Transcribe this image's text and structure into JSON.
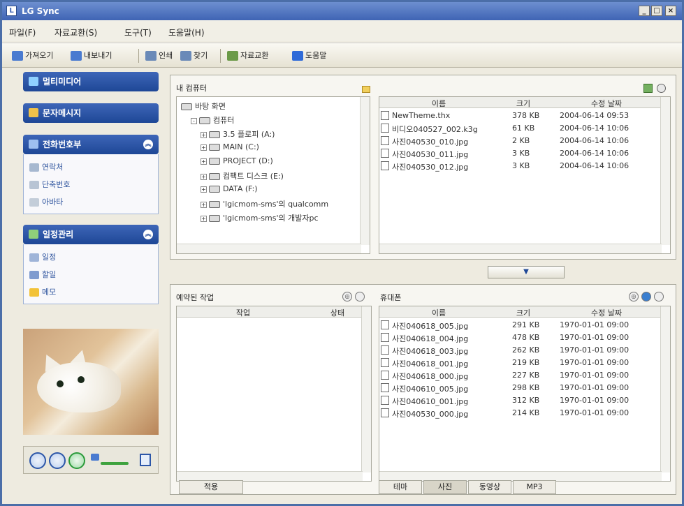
{
  "window": {
    "title": "LG Sync",
    "min_label": "_",
    "max_label": "□",
    "close_label": "×"
  },
  "menu": [
    "파일(F)",
    "자료교환(S)",
    "도구(T)",
    "도움말(H)"
  ],
  "toolbar": [
    {
      "label": "가져오기",
      "icon": "import-icon",
      "color": "#4a7bd0"
    },
    {
      "label": "내보내기",
      "icon": "export-icon",
      "color": "#4a7bd0"
    },
    {
      "label": "인쇄",
      "icon": "print-icon",
      "color": "#6a8ab8"
    },
    {
      "label": "찾기",
      "icon": "find-icon",
      "color": "#6a8ab8"
    },
    {
      "label": "자료교환",
      "icon": "exchange-icon",
      "color": "#6b9a48"
    },
    {
      "label": "도움말",
      "icon": "help-icon",
      "color": "#2f6bd8"
    }
  ],
  "sidebar": {
    "multimedia": "멀티미디어",
    "messages": "문자메시지",
    "phonebook": {
      "title": "전화번호부",
      "items": [
        "연락처",
        "단축번호",
        "아바타"
      ]
    },
    "schedule": {
      "title": "일정관리",
      "items": [
        "일정",
        "할일",
        "메모"
      ]
    }
  },
  "mycomputer": {
    "label": "내 컴퓨터",
    "tree": [
      {
        "label": "바탕 화면",
        "level": 0,
        "expander": ""
      },
      {
        "label": "컴퓨터",
        "level": 1,
        "expander": "-"
      },
      {
        "label": "3.5 플로피 (A:)",
        "level": 2,
        "expander": "+"
      },
      {
        "label": "MAIN (C:)",
        "level": 2,
        "expander": "+"
      },
      {
        "label": "PROJECT (D:)",
        "level": 2,
        "expander": "+"
      },
      {
        "label": "컴팩트 디스크 (E:)",
        "level": 2,
        "expander": "+"
      },
      {
        "label": "DATA (F:)",
        "level": 2,
        "expander": "+"
      },
      {
        "label": "'lgicmom-sms'의 qualcomm",
        "level": 2,
        "expander": "+"
      },
      {
        "label": "'lgicmom-sms'의 개발자pc",
        "level": 2,
        "expander": "+"
      }
    ],
    "headers": {
      "name": "이름",
      "size": "크기",
      "date": "수정 날짜"
    },
    "files": [
      {
        "name": "NewTheme.thx",
        "size": "378 KB",
        "date": "2004-06-14 09:53"
      },
      {
        "name": "비디오040527_002.k3g",
        "size": "61 KB",
        "date": "2004-06-14 10:06"
      },
      {
        "name": "사진040530_010.jpg",
        "size": "2 KB",
        "date": "2004-06-14 10:06"
      },
      {
        "name": "사진040530_011.jpg",
        "size": "3 KB",
        "date": "2004-06-14 10:06"
      },
      {
        "name": "사진040530_012.jpg",
        "size": "3 KB",
        "date": "2004-06-14 10:06"
      }
    ]
  },
  "transfer_arrow": "▼",
  "reserved": {
    "label": "예약된 작업",
    "headers": {
      "task": "작업",
      "status": "상태"
    },
    "apply": "적용"
  },
  "phone": {
    "label": "휴대폰",
    "headers": {
      "name": "이름",
      "size": "크기",
      "date": "수정 날짜"
    },
    "files": [
      {
        "name": "사진040618_005.jpg",
        "size": "291 KB",
        "date": "1970-01-01 09:00"
      },
      {
        "name": "사진040618_004.jpg",
        "size": "478 KB",
        "date": "1970-01-01 09:00"
      },
      {
        "name": "사진040618_003.jpg",
        "size": "262 KB",
        "date": "1970-01-01 09:00"
      },
      {
        "name": "사진040618_001.jpg",
        "size": "219 KB",
        "date": "1970-01-01 09:00"
      },
      {
        "name": "사진040618_000.jpg",
        "size": "227 KB",
        "date": "1970-01-01 09:00"
      },
      {
        "name": "사진040610_005.jpg",
        "size": "298 KB",
        "date": "1970-01-01 09:00"
      },
      {
        "name": "사진040610_001.jpg",
        "size": "312 KB",
        "date": "1970-01-01 09:00"
      },
      {
        "name": "사진040530_000.jpg",
        "size": "214 KB",
        "date": "1970-01-01 09:00"
      }
    ],
    "tabs": [
      "테마",
      "사진",
      "동영상",
      "MP3"
    ],
    "active_tab": "사진"
  },
  "colors": {
    "accent": "#1e4796",
    "title": "#3f64b4"
  }
}
